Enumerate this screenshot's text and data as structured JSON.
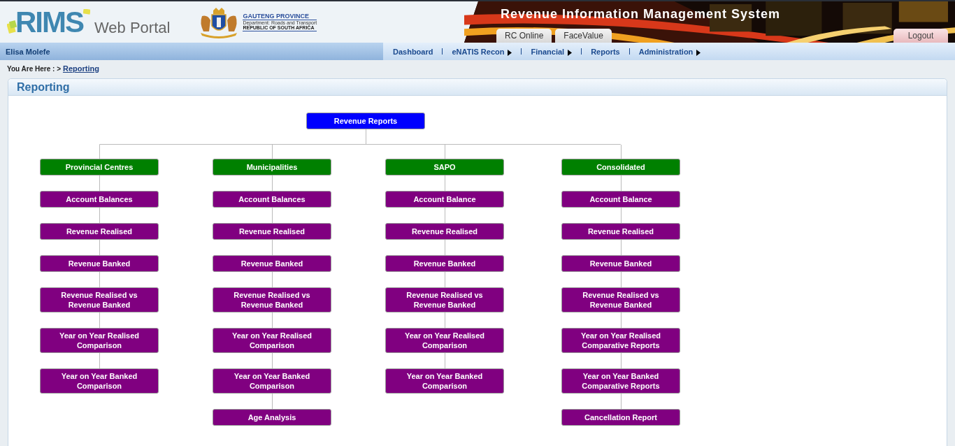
{
  "header": {
    "logo": "RIMS",
    "portal": "Web Portal",
    "province": "GAUTENG PROVINCE",
    "department": "Department: Roads and Transport",
    "country": "REPUBLIC OF SOUTH AFRICA",
    "system_title": "Revenue Information Management System",
    "tabs": [
      {
        "label": "RC Online"
      },
      {
        "label": "FaceValue"
      }
    ],
    "logout": "Logout"
  },
  "user": "Elisa Molefe",
  "menu": [
    {
      "label": "Dashboard",
      "submenu": false
    },
    {
      "label": "eNATIS Recon",
      "submenu": true
    },
    {
      "label": "Financial",
      "submenu": true
    },
    {
      "label": "Reports",
      "submenu": false
    },
    {
      "label": "Administration",
      "submenu": true
    }
  ],
  "breadcrumb": {
    "prefix": "You Are Here : >",
    "link": "Reporting"
  },
  "panel_title": "Reporting",
  "tree": {
    "label": "Revenue Reports",
    "kind": "root",
    "children": [
      {
        "label": "Provincial Centres",
        "kind": "category",
        "children": [
          {
            "label": "Account Balances",
            "kind": "report"
          },
          {
            "label": "Revenue Realised",
            "kind": "report"
          },
          {
            "label": "Revenue Banked",
            "kind": "report"
          },
          {
            "label": "Revenue Realised vs Revenue Banked",
            "kind": "report"
          },
          {
            "label": "Year on Year Realised Comparison",
            "kind": "report"
          },
          {
            "label": "Year on Year Banked Comparison",
            "kind": "report"
          }
        ]
      },
      {
        "label": "Municipalities",
        "kind": "category",
        "children": [
          {
            "label": "Account Balances",
            "kind": "report"
          },
          {
            "label": "Revenue Realised",
            "kind": "report"
          },
          {
            "label": "Revenue Banked",
            "kind": "report"
          },
          {
            "label": "Revenue Realised vs Revenue Banked",
            "kind": "report"
          },
          {
            "label": "Year on Year Realised Comparison",
            "kind": "report"
          },
          {
            "label": "Year on Year Banked Comparison",
            "kind": "report"
          },
          {
            "label": "Age Analysis",
            "kind": "report"
          }
        ]
      },
      {
        "label": "SAPO",
        "kind": "category",
        "children": [
          {
            "label": "Account Balance",
            "kind": "report"
          },
          {
            "label": "Revenue Realised",
            "kind": "report"
          },
          {
            "label": "Revenue Banked",
            "kind": "report"
          },
          {
            "label": "Revenue Realised vs Revenue Banked",
            "kind": "report"
          },
          {
            "label": "Year on Year Realised Comparison",
            "kind": "report"
          },
          {
            "label": "Year on Year Banked Comparison",
            "kind": "report"
          }
        ]
      },
      {
        "label": "Consolidated",
        "kind": "category",
        "children": [
          {
            "label": "Account Balance",
            "kind": "report"
          },
          {
            "label": "Revenue Realised",
            "kind": "report"
          },
          {
            "label": "Revenue Banked",
            "kind": "report"
          },
          {
            "label": "Revenue Realised vs Revenue Banked",
            "kind": "report"
          },
          {
            "label": "Year on Year Realised Comparative Reports",
            "kind": "report"
          },
          {
            "label": "Year on Year Banked Comparative Reports",
            "kind": "report"
          },
          {
            "label": "Cancellation Report",
            "kind": "report"
          }
        ]
      }
    ]
  }
}
